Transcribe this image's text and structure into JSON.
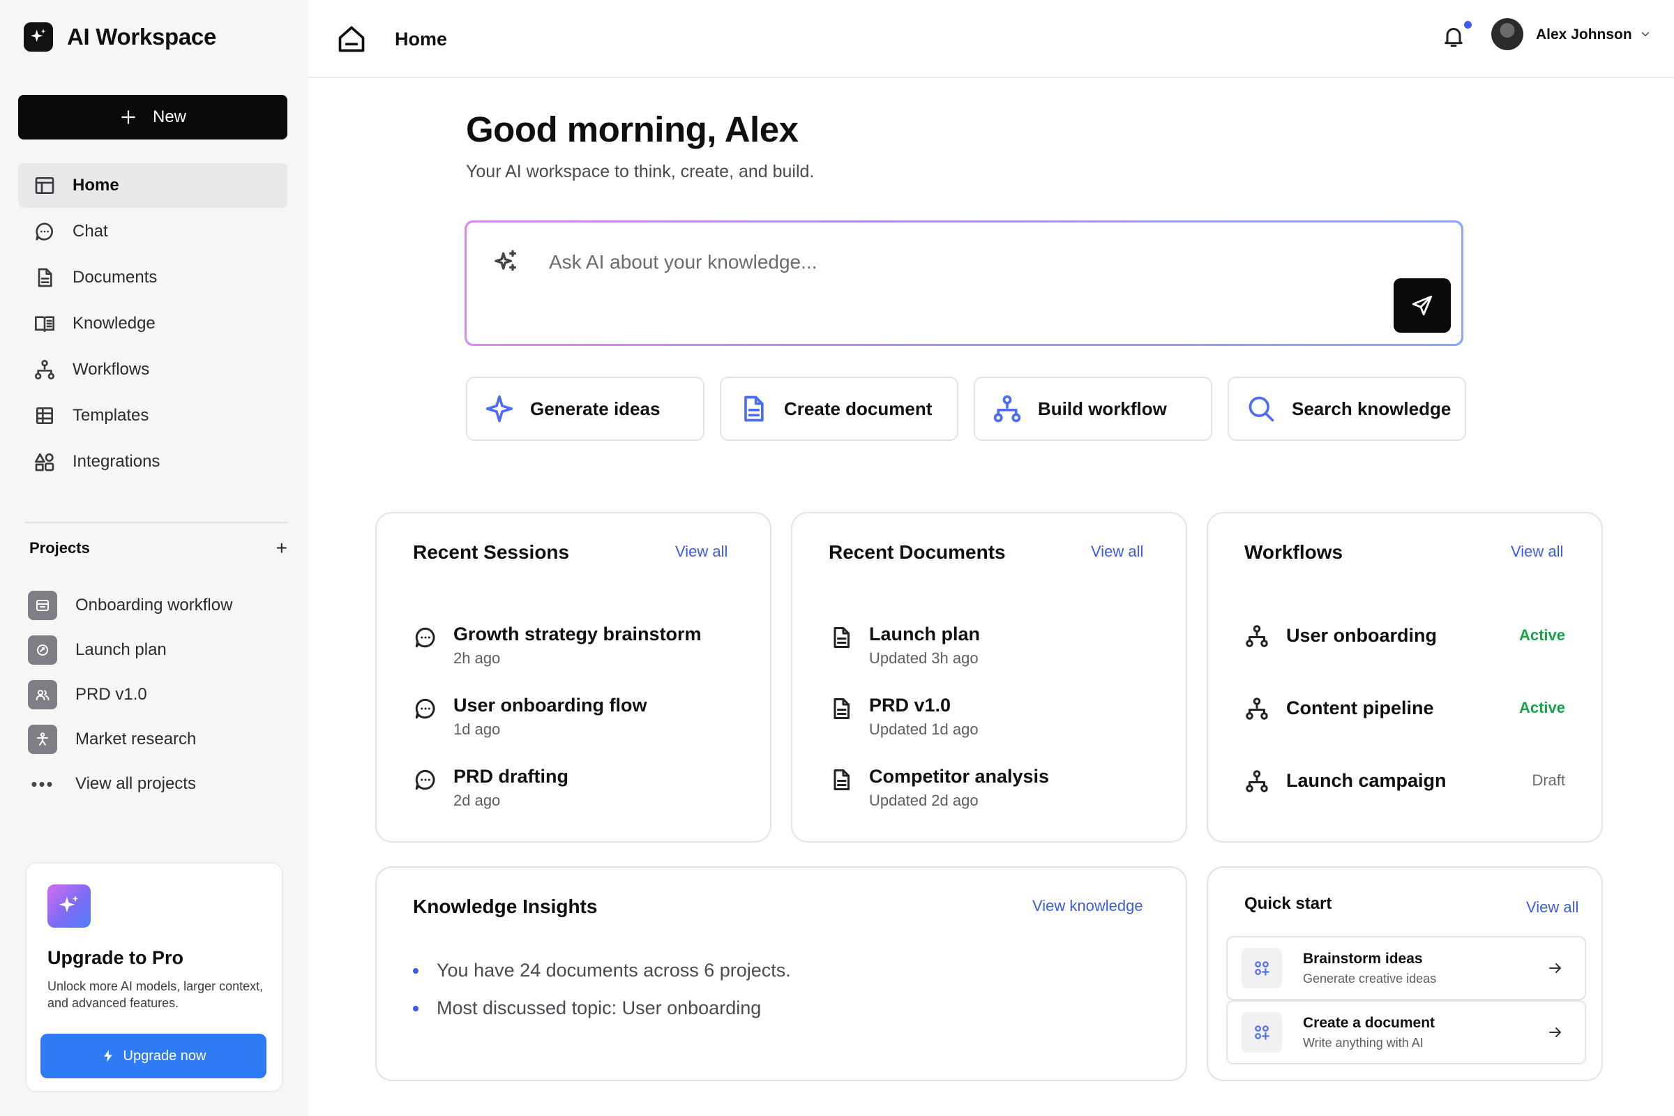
{
  "brand": {
    "name": "AI Workspace"
  },
  "sidebar": {
    "new_label": "New",
    "nav": [
      {
        "label": "Home",
        "icon": "layout-icon",
        "active": true
      },
      {
        "label": "Chat",
        "icon": "chat-icon"
      },
      {
        "label": "Documents",
        "icon": "document-icon"
      },
      {
        "label": "Knowledge",
        "icon": "book-icon"
      },
      {
        "label": "Workflows",
        "icon": "workflow-icon"
      },
      {
        "label": "Templates",
        "icon": "grid-icon"
      },
      {
        "label": "Integrations",
        "icon": "shapes-icon"
      }
    ],
    "projects_title": "Projects",
    "projects_add": "+",
    "projects": [
      {
        "label": "Onboarding workflow",
        "icon": "inbox-icon"
      },
      {
        "label": "Launch plan",
        "icon": "rocket-icon"
      },
      {
        "label": "PRD v1.0",
        "icon": "users-icon"
      },
      {
        "label": "Market research",
        "icon": "person-icon"
      },
      {
        "label": "View all projects",
        "icon": "more-icon"
      }
    ],
    "upgrade": {
      "title": "Upgrade to Pro",
      "description": "Unlock more AI models, larger context, and advanced features.",
      "button": "Upgrade now"
    }
  },
  "topbar": {
    "title": "Home",
    "user_name": "Alex Johnson"
  },
  "main": {
    "greeting": "Good morning, Alex",
    "subtitle": "Your AI workspace to think, create, and build.",
    "ask_placeholder": "Ask AI about your knowledge...",
    "quick_actions": [
      {
        "label": "Generate ideas",
        "icon": "sparkle-icon"
      },
      {
        "label": "Create document",
        "icon": "document-icon"
      },
      {
        "label": "Build workflow",
        "icon": "workflow-icon"
      },
      {
        "label": "Search knowledge",
        "icon": "search-icon"
      }
    ]
  },
  "recent_sessions": {
    "title": "Recent Sessions",
    "link": "View all",
    "items": [
      {
        "title": "Growth strategy brainstorm",
        "sub": "2h ago"
      },
      {
        "title": "User onboarding flow",
        "sub": "1d ago"
      },
      {
        "title": "PRD drafting",
        "sub": "2d ago"
      }
    ]
  },
  "recent_documents": {
    "title": "Recent Documents",
    "link": "View all",
    "items": [
      {
        "title": "Launch plan",
        "sub": "Updated 3h ago"
      },
      {
        "title": "PRD v1.0",
        "sub": "Updated 1d ago"
      },
      {
        "title": "Competitor analysis",
        "sub": "Updated 2d ago"
      }
    ]
  },
  "workflows": {
    "title": "Workflows",
    "link": "View all",
    "items": [
      {
        "name": "User onboarding",
        "status": "Active",
        "status_color": "#16a34a"
      },
      {
        "name": "Content pipeline",
        "status": "Active",
        "status_color": "#16a34a"
      },
      {
        "name": "Launch campaign",
        "status": "Draft",
        "status_color": "#6b6b70"
      }
    ]
  },
  "insights": {
    "title": "Knowledge Insights",
    "link": "View knowledge",
    "items": [
      "You have 24 documents across 6 projects.",
      "Most discussed topic: User onboarding"
    ]
  },
  "quick_start": {
    "title": "Quick start",
    "link": "View all",
    "items": [
      {
        "title": "Brainstorm ideas",
        "sub": "Generate creative ideas"
      },
      {
        "title": "Create a document",
        "sub": "Write anything with AI"
      }
    ]
  },
  "colors": {
    "accent": "#3b5ce6",
    "upgrade_button": "#2f7bf6",
    "active_status": "#16a34a"
  }
}
